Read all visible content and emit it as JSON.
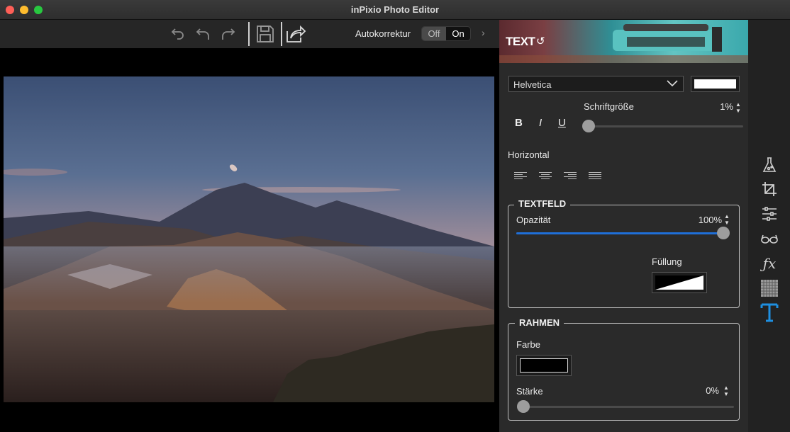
{
  "window": {
    "title": "inPixio Photo Editor"
  },
  "toolbar": {
    "icons": [
      "undo-icon",
      "undo-all-icon",
      "redo-icon",
      "save-icon",
      "share-icon"
    ],
    "auto_label": "Autokorrektur",
    "toggle_off": "Off",
    "toggle_on": "On",
    "toggle_state": "Off"
  },
  "panel": {
    "title": "TEXT",
    "font": "Helvetica",
    "text_color": "#ffffff",
    "font_size_label": "Schriftgröße",
    "font_size_value": "1%",
    "font_size_percent": 1,
    "style_buttons": [
      "B",
      "I",
      "U"
    ],
    "horizontal_label": "Horizontal",
    "align_icons": [
      "align-left-icon",
      "align-center-icon",
      "align-right-icon",
      "align-justify-icon"
    ],
    "textfeld": {
      "title": "TEXTFELD",
      "opacity_label": "Opazität",
      "opacity_value": "100%",
      "opacity_percent": 100,
      "fill_label": "Füllung"
    },
    "rahmen": {
      "title": "RAHMEN",
      "color_label": "Farbe",
      "color": "#000000",
      "strength_label": "Stärke",
      "strength_value": "0%",
      "strength_percent": 0
    }
  },
  "tools": [
    "potion-icon",
    "crop-icon",
    "adjust-icon",
    "glasses-icon",
    "fx-icon",
    "texture-icon",
    "text-tool-icon"
  ],
  "accent_color": "#1e8fe0"
}
